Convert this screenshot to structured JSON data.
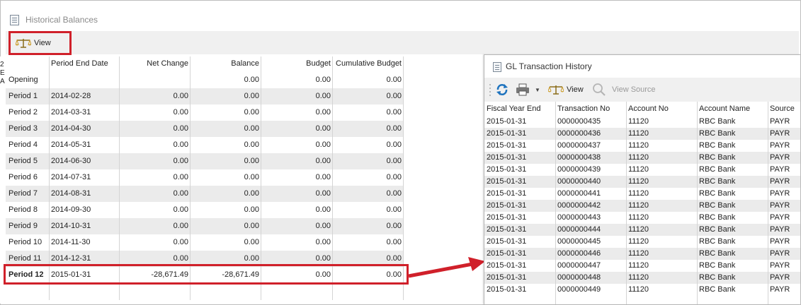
{
  "historical": {
    "title": "Historical Balances",
    "view_label": "View",
    "left_strip": [
      "2",
      "E",
      "A"
    ],
    "columns": {
      "period": "",
      "end_date": "Period End Date",
      "net_change": "Net Change",
      "balance": "Balance",
      "budget": "Budget",
      "cumulative_budget": "Cumulative Budget"
    },
    "rows": [
      {
        "period": "Opening",
        "date": "",
        "net": "",
        "bal": "0.00",
        "bud": "0.00",
        "cum": "0.00"
      },
      {
        "period": "Period 1",
        "date": "2014-02-28",
        "net": "0.00",
        "bal": "0.00",
        "bud": "0.00",
        "cum": "0.00"
      },
      {
        "period": "Period 2",
        "date": "2014-03-31",
        "net": "0.00",
        "bal": "0.00",
        "bud": "0.00",
        "cum": "0.00"
      },
      {
        "period": "Period 3",
        "date": "2014-04-30",
        "net": "0.00",
        "bal": "0.00",
        "bud": "0.00",
        "cum": "0.00"
      },
      {
        "period": "Period 4",
        "date": "2014-05-31",
        "net": "0.00",
        "bal": "0.00",
        "bud": "0.00",
        "cum": "0.00"
      },
      {
        "period": "Period 5",
        "date": "2014-06-30",
        "net": "0.00",
        "bal": "0.00",
        "bud": "0.00",
        "cum": "0.00"
      },
      {
        "period": "Period 6",
        "date": "2014-07-31",
        "net": "0.00",
        "bal": "0.00",
        "bud": "0.00",
        "cum": "0.00"
      },
      {
        "period": "Period 7",
        "date": "2014-08-31",
        "net": "0.00",
        "bal": "0.00",
        "bud": "0.00",
        "cum": "0.00"
      },
      {
        "period": "Period 8",
        "date": "2014-09-30",
        "net": "0.00",
        "bal": "0.00",
        "bud": "0.00",
        "cum": "0.00"
      },
      {
        "period": "Period 9",
        "date": "2014-10-31",
        "net": "0.00",
        "bal": "0.00",
        "bud": "0.00",
        "cum": "0.00"
      },
      {
        "period": "Period 10",
        "date": "2014-11-30",
        "net": "0.00",
        "bal": "0.00",
        "bud": "0.00",
        "cum": "0.00"
      },
      {
        "period": "Period 11",
        "date": "2014-12-31",
        "net": "0.00",
        "bal": "0.00",
        "bud": "0.00",
        "cum": "0.00"
      },
      {
        "period": "Period 12",
        "date": "2015-01-31",
        "net": "-28,671.49",
        "bal": "-28,671.49",
        "bud": "0.00",
        "cum": "0.00"
      }
    ]
  },
  "gl": {
    "title": "GL Transaction History",
    "toolbar": {
      "view_label": "View",
      "view_source_label": "View Source"
    },
    "columns": {
      "fiscal_year_end": "Fiscal Year End",
      "transaction_no": "Transaction No",
      "account_no": "Account No",
      "account_name": "Account Name",
      "source": "Source"
    },
    "rows": [
      {
        "fye": "2015-01-31",
        "tno": "0000000435",
        "acct": "11120",
        "name": "RBC Bank",
        "src": "PAYR"
      },
      {
        "fye": "2015-01-31",
        "tno": "0000000436",
        "acct": "11120",
        "name": "RBC Bank",
        "src": "PAYR"
      },
      {
        "fye": "2015-01-31",
        "tno": "0000000437",
        "acct": "11120",
        "name": "RBC Bank",
        "src": "PAYR"
      },
      {
        "fye": "2015-01-31",
        "tno": "0000000438",
        "acct": "11120",
        "name": "RBC Bank",
        "src": "PAYR"
      },
      {
        "fye": "2015-01-31",
        "tno": "0000000439",
        "acct": "11120",
        "name": "RBC Bank",
        "src": "PAYR"
      },
      {
        "fye": "2015-01-31",
        "tno": "0000000440",
        "acct": "11120",
        "name": "RBC Bank",
        "src": "PAYR"
      },
      {
        "fye": "2015-01-31",
        "tno": "0000000441",
        "acct": "11120",
        "name": "RBC Bank",
        "src": "PAYR"
      },
      {
        "fye": "2015-01-31",
        "tno": "0000000442",
        "acct": "11120",
        "name": "RBC Bank",
        "src": "PAYR"
      },
      {
        "fye": "2015-01-31",
        "tno": "0000000443",
        "acct": "11120",
        "name": "RBC Bank",
        "src": "PAYR"
      },
      {
        "fye": "2015-01-31",
        "tno": "0000000444",
        "acct": "11120",
        "name": "RBC Bank",
        "src": "PAYR"
      },
      {
        "fye": "2015-01-31",
        "tno": "0000000445",
        "acct": "11120",
        "name": "RBC Bank",
        "src": "PAYR"
      },
      {
        "fye": "2015-01-31",
        "tno": "0000000446",
        "acct": "11120",
        "name": "RBC Bank",
        "src": "PAYR"
      },
      {
        "fye": "2015-01-31",
        "tno": "0000000447",
        "acct": "11120",
        "name": "RBC Bank",
        "src": "PAYR"
      },
      {
        "fye": "2015-01-31",
        "tno": "0000000448",
        "acct": "11120",
        "name": "RBC Bank",
        "src": "PAYR"
      },
      {
        "fye": "2015-01-31",
        "tno": "0000000449",
        "acct": "11120",
        "name": "RBC Bank",
        "src": "PAYR"
      }
    ]
  },
  "colors": {
    "highlight": "#d0202a",
    "row_alt": "#ebebeb",
    "toolbar_bg": "#f0f0f0",
    "refresh_icon": "#1e73be"
  }
}
